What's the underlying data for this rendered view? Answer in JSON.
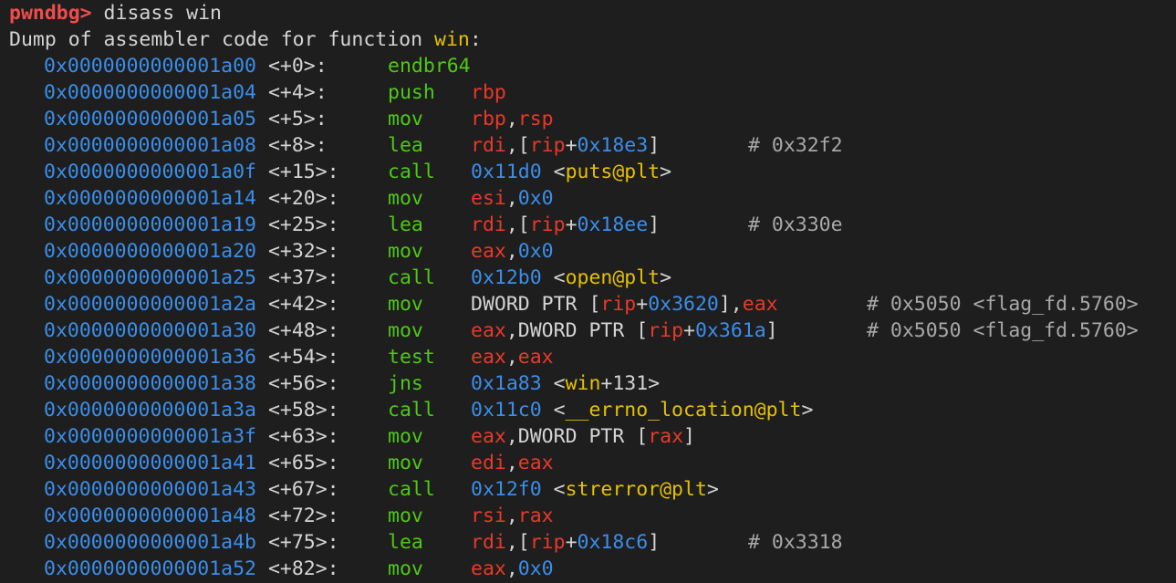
{
  "prompt": {
    "label": "pwndbg>",
    "command": " disass win"
  },
  "header": {
    "text": "Dump of assembler code for function ",
    "func": "win",
    "suffix": ":"
  },
  "instructions": [
    {
      "addr": "0x0000000000001a00",
      "off": "<+0>:",
      "mn": "endbr64",
      "ops": []
    },
    {
      "addr": "0x0000000000001a04",
      "off": "<+4>:",
      "mn": "push",
      "ops": [
        {
          "t": "reg",
          "v": "rbp"
        }
      ]
    },
    {
      "addr": "0x0000000000001a05",
      "off": "<+5>:",
      "mn": "mov",
      "ops": [
        {
          "t": "reg",
          "v": "rbp"
        },
        {
          "t": "plain",
          "v": ","
        },
        {
          "t": "reg",
          "v": "rsp"
        }
      ]
    },
    {
      "addr": "0x0000000000001a08",
      "off": "<+8>:",
      "mn": "lea",
      "ops": [
        {
          "t": "reg",
          "v": "rdi"
        },
        {
          "t": "plain",
          "v": ",["
        },
        {
          "t": "reg",
          "v": "rip"
        },
        {
          "t": "plain",
          "v": "+"
        },
        {
          "t": "num",
          "v": "0x18e3"
        },
        {
          "t": "plain",
          "v": "]"
        }
      ],
      "comment": "# 0x32f2",
      "cpos": 820
    },
    {
      "addr": "0x0000000000001a0f",
      "off": "<+15>:",
      "mn": "call",
      "ops": [
        {
          "t": "num",
          "v": "0x11d0"
        },
        {
          "t": "plain",
          "v": " <"
        },
        {
          "t": "sym",
          "v": "puts@plt"
        },
        {
          "t": "plain",
          "v": ">"
        }
      ]
    },
    {
      "addr": "0x0000000000001a14",
      "off": "<+20>:",
      "mn": "mov",
      "ops": [
        {
          "t": "reg",
          "v": "esi"
        },
        {
          "t": "plain",
          "v": ","
        },
        {
          "t": "num",
          "v": "0x0"
        }
      ]
    },
    {
      "addr": "0x0000000000001a19",
      "off": "<+25>:",
      "mn": "lea",
      "ops": [
        {
          "t": "reg",
          "v": "rdi"
        },
        {
          "t": "plain",
          "v": ",["
        },
        {
          "t": "reg",
          "v": "rip"
        },
        {
          "t": "plain",
          "v": "+"
        },
        {
          "t": "num",
          "v": "0x18ee"
        },
        {
          "t": "plain",
          "v": "]"
        }
      ],
      "comment": "# 0x330e",
      "cpos": 820
    },
    {
      "addr": "0x0000000000001a20",
      "off": "<+32>:",
      "mn": "mov",
      "ops": [
        {
          "t": "reg",
          "v": "eax"
        },
        {
          "t": "plain",
          "v": ","
        },
        {
          "t": "num",
          "v": "0x0"
        }
      ]
    },
    {
      "addr": "0x0000000000001a25",
      "off": "<+37>:",
      "mn": "call",
      "ops": [
        {
          "t": "num",
          "v": "0x12b0"
        },
        {
          "t": "plain",
          "v": " <"
        },
        {
          "t": "sym",
          "v": "open@plt"
        },
        {
          "t": "plain",
          "v": ">"
        }
      ]
    },
    {
      "addr": "0x0000000000001a2a",
      "off": "<+42>:",
      "mn": "mov",
      "ops": [
        {
          "t": "plain",
          "v": "DWORD PTR ["
        },
        {
          "t": "reg",
          "v": "rip"
        },
        {
          "t": "plain",
          "v": "+"
        },
        {
          "t": "num",
          "v": "0x3620"
        },
        {
          "t": "plain",
          "v": "],"
        },
        {
          "t": "reg",
          "v": "eax"
        }
      ],
      "comment": "# 0x5050 <flag_fd.5760>",
      "cpos": 950
    },
    {
      "addr": "0x0000000000001a30",
      "off": "<+48>:",
      "mn": "mov",
      "ops": [
        {
          "t": "reg",
          "v": "eax"
        },
        {
          "t": "plain",
          "v": ",DWORD PTR ["
        },
        {
          "t": "reg",
          "v": "rip"
        },
        {
          "t": "plain",
          "v": "+"
        },
        {
          "t": "num",
          "v": "0x361a"
        },
        {
          "t": "plain",
          "v": "]"
        }
      ],
      "comment": "# 0x5050 <flag_fd.5760>",
      "cpos": 950
    },
    {
      "addr": "0x0000000000001a36",
      "off": "<+54>:",
      "mn": "test",
      "ops": [
        {
          "t": "reg",
          "v": "eax"
        },
        {
          "t": "plain",
          "v": ","
        },
        {
          "t": "reg",
          "v": "eax"
        }
      ]
    },
    {
      "addr": "0x0000000000001a38",
      "off": "<+56>:",
      "mn": "jns",
      "ops": [
        {
          "t": "num",
          "v": "0x1a83"
        },
        {
          "t": "plain",
          "v": " <"
        },
        {
          "t": "sym",
          "v": "win"
        },
        {
          "t": "plain",
          "v": "+131>"
        }
      ]
    },
    {
      "addr": "0x0000000000001a3a",
      "off": "<+58>:",
      "mn": "call",
      "ops": [
        {
          "t": "num",
          "v": "0x11c0"
        },
        {
          "t": "plain",
          "v": " <"
        },
        {
          "t": "sym",
          "v": "__errno_location@plt"
        },
        {
          "t": "plain",
          "v": ">"
        }
      ]
    },
    {
      "addr": "0x0000000000001a3f",
      "off": "<+63>:",
      "mn": "mov",
      "ops": [
        {
          "t": "reg",
          "v": "eax"
        },
        {
          "t": "plain",
          "v": ",DWORD PTR ["
        },
        {
          "t": "reg",
          "v": "rax"
        },
        {
          "t": "plain",
          "v": "]"
        }
      ]
    },
    {
      "addr": "0x0000000000001a41",
      "off": "<+65>:",
      "mn": "mov",
      "ops": [
        {
          "t": "reg",
          "v": "edi"
        },
        {
          "t": "plain",
          "v": ","
        },
        {
          "t": "reg",
          "v": "eax"
        }
      ]
    },
    {
      "addr": "0x0000000000001a43",
      "off": "<+67>:",
      "mn": "call",
      "ops": [
        {
          "t": "num",
          "v": "0x12f0"
        },
        {
          "t": "plain",
          "v": " <"
        },
        {
          "t": "sym",
          "v": "strerror@plt"
        },
        {
          "t": "plain",
          "v": ">"
        }
      ]
    },
    {
      "addr": "0x0000000000001a48",
      "off": "<+72>:",
      "mn": "mov",
      "ops": [
        {
          "t": "reg",
          "v": "rsi"
        },
        {
          "t": "plain",
          "v": ","
        },
        {
          "t": "reg",
          "v": "rax"
        }
      ]
    },
    {
      "addr": "0x0000000000001a4b",
      "off": "<+75>:",
      "mn": "lea",
      "ops": [
        {
          "t": "reg",
          "v": "rdi"
        },
        {
          "t": "plain",
          "v": ",["
        },
        {
          "t": "reg",
          "v": "rip"
        },
        {
          "t": "plain",
          "v": "+"
        },
        {
          "t": "num",
          "v": "0x18c6"
        },
        {
          "t": "plain",
          "v": "]"
        }
      ],
      "comment": "# 0x3318",
      "cpos": 820
    },
    {
      "addr": "0x0000000000001a52",
      "off": "<+82>:",
      "mn": "mov",
      "ops": [
        {
          "t": "reg",
          "v": "eax"
        },
        {
          "t": "plain",
          "v": ","
        },
        {
          "t": "num",
          "v": "0x0"
        }
      ]
    }
  ],
  "colors": {
    "background": "#1e1e1e",
    "prompt": "#f14c4c",
    "address": "#3b8eea",
    "mnemonic": "#4ec914",
    "register": "#e8392a",
    "symbol": "#e5c000",
    "comment": "#a8a8a8"
  }
}
